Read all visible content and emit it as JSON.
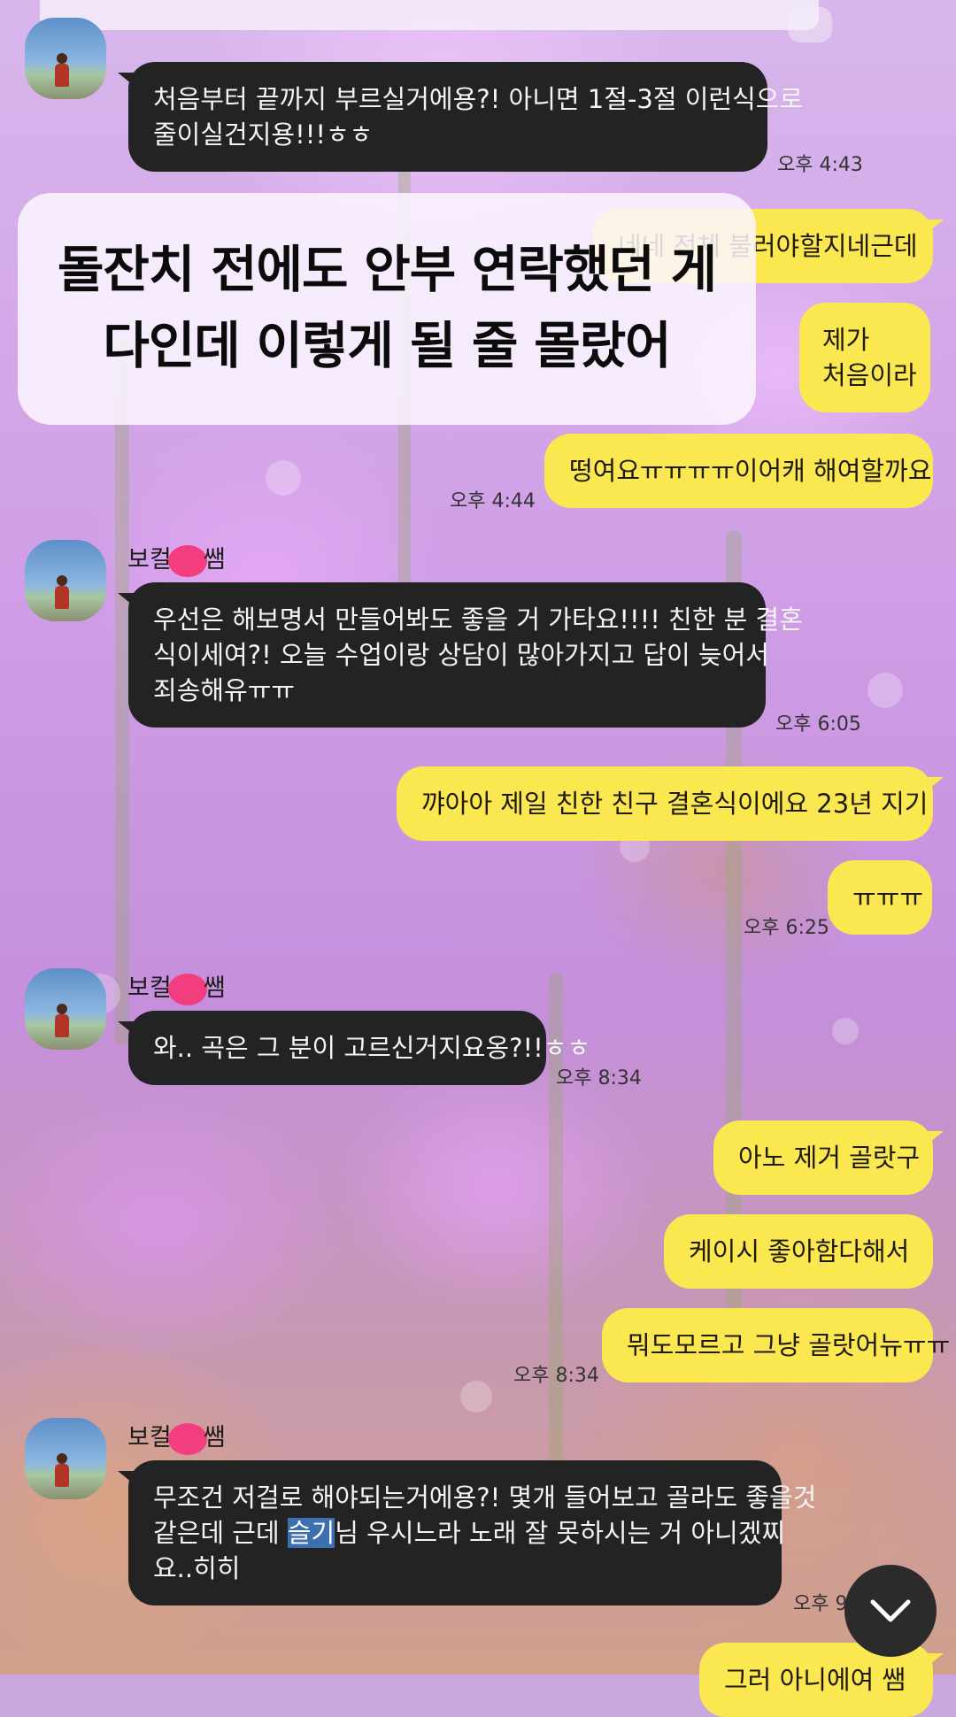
{
  "overlay_caption": {
    "line1": "돌잔치 전에도 안부 연락했던 게",
    "line2": "다인데 이렇게 될 줄 몰랐어"
  },
  "header": {
    "partial_name": "..."
  },
  "messages": {
    "m1": {
      "text_line1": "처음부터 끝까지 부르실거에용?! 아니면 1절-3절 이런식으로",
      "text_line2": "줄이실건지용!!!ㅎㅎ",
      "time": "오후 4:43"
    },
    "m2": {
      "text": "네네 전체 불러야할지네근데"
    },
    "m3": {
      "text_line1": "제가",
      "text_line2": "처음이라"
    },
    "m4": {
      "text": "떵여요ㅠㅠㅠㅠ이어캐 해여할까요",
      "time": "오후 4:44"
    },
    "g2_sender": {
      "prefix": "보컬",
      "suffix": "쌤"
    },
    "m5": {
      "text_line1": "우선은 해보명서 만들어봐도 좋을 거 가타요!!!! 친한 분 결혼",
      "text_line2": "식이세여?! 오늘 수업이랑 상담이 많아가지고 답이 늦어서",
      "text_line3": "죄송해유ㅠㅠ",
      "time": "오후 6:05"
    },
    "m6": {
      "text": "꺄아아 제일 친한 친구 결혼식이에요 23년 지기"
    },
    "m7": {
      "text": "ㅠㅠㅠ",
      "time": "오후 6:25"
    },
    "g3_sender": {
      "prefix": "보컬",
      "suffix": "쌤"
    },
    "m8": {
      "text": "와.. 곡은 그 분이 고르신거지요옹?!!ㅎㅎ",
      "time": "오후 8:34"
    },
    "m9": {
      "text": "아노 제거 골랏구"
    },
    "m10": {
      "text": "케이시 좋아함다해서"
    },
    "m11": {
      "text": "뭐도모르고 그냥 골랏어뉴ㅠㅠ",
      "time": "오후 8:34"
    },
    "g4_sender": {
      "prefix": "보컬",
      "suffix": "쌤"
    },
    "m12": {
      "text_line1": "무조건 저걸로 해야되는거에용?! 몇개 들어보고 골라도 좋을것",
      "line2_pre": "같은데 근데 ",
      "line2_hl": "슬기",
      "line2_post": "님 우시느라 노래 잘  못하시는 거 아니겠찌",
      "text_line3": "요..히히",
      "time": "오후 9:"
    },
    "m13": {
      "text": "그러 아니에여 쌤"
    }
  },
  "icons": {
    "scroll": "chevron-down-icon"
  },
  "colors": {
    "mine_bubble": "#fbe74f",
    "their_bubble": "#232323",
    "redaction": "#f23e7f"
  }
}
